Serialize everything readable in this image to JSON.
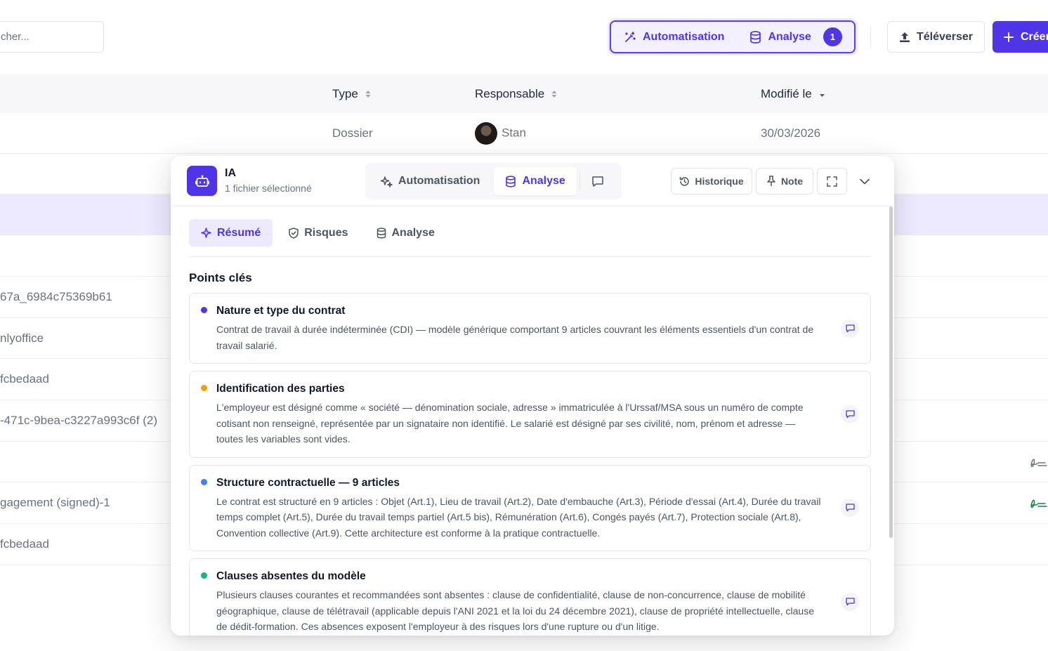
{
  "toolbar": {
    "search_placeholder": "cher...",
    "automation_label": "Automatisation",
    "analysis_label": "Analyse",
    "analysis_badge": "1",
    "upload_label": "Téléverser",
    "create_label": "Créer"
  },
  "table": {
    "columns": {
      "type": "Type",
      "owner": "Responsable",
      "modified": "Modifié le"
    },
    "first_row": {
      "type": "Dossier",
      "owner": "Stan",
      "modified": "30/03/2026"
    },
    "rows": [
      "67a_6984c75369b61",
      "nlyoffice",
      "fcbedaad",
      "-471c-9bea-c3227a993c6f (2)",
      "",
      "gagement (signed)-1",
      "fcbedaad"
    ],
    "signature_colors": {
      "grey": "#6b7280",
      "green": "#15803d"
    }
  },
  "panel": {
    "title": "IA",
    "subtitle": "1 fichier sélectionné",
    "tabs": {
      "automation": "Automatisation",
      "analysis": "Analyse"
    },
    "history_label": "Historique",
    "note_label": "Note",
    "subtabs": {
      "summary": "Résumé",
      "risks": "Risques",
      "analysis": "Analyse"
    },
    "section_title": "Points clés",
    "cards": [
      {
        "title": "Nature et type du contrat",
        "text": "Contrat de travail à durée indéterminée (CDI) — modèle générique comportant 9 articles couvrant les éléments essentiels d'un contrat de travail salarié.",
        "color": "#4f35e6"
      },
      {
        "title": "Identification des parties",
        "text": "L'employeur est désigné comme « société — dénomination sociale, adresse » immatriculée à l'Urssaf/MSA sous un numéro de compte cotisant non renseigné, représentée par un signataire non identifié. Le salarié est désigné par ses civilité, nom, prénom et adresse — toutes les variables sont vides.",
        "color": "#f59e0b"
      },
      {
        "title": "Structure contractuelle — 9 articles",
        "text": "Le contrat est structuré en 9 articles : Objet (Art.1), Lieu de travail (Art.2), Date d'embauche (Art.3), Période d'essai (Art.4), Durée du travail temps complet (Art.5), Durée du travail temps partiel (Art.5 bis), Rémunération (Art.6), Congés payés (Art.7), Protection sociale (Art.8), Convention collective (Art.9). Cette architecture est conforme à la pratique contractuelle.",
        "color": "#3b82f6"
      },
      {
        "title": "Clauses absentes du modèle",
        "text": "Plusieurs clauses courantes et recommandées sont absentes : clause de confidentialité, clause de non-concurrence, clause de mobilité géographique, clause de télétravail (applicable depuis l'ANI 2021 et la loi du 24 décembre 2021), clause de propriété intellectuelle, clause de dédit-formation. Ces absences exposent l'employeur à des risques lors d'une rupture ou d'un litige.",
        "color": "#10b981"
      }
    ]
  }
}
